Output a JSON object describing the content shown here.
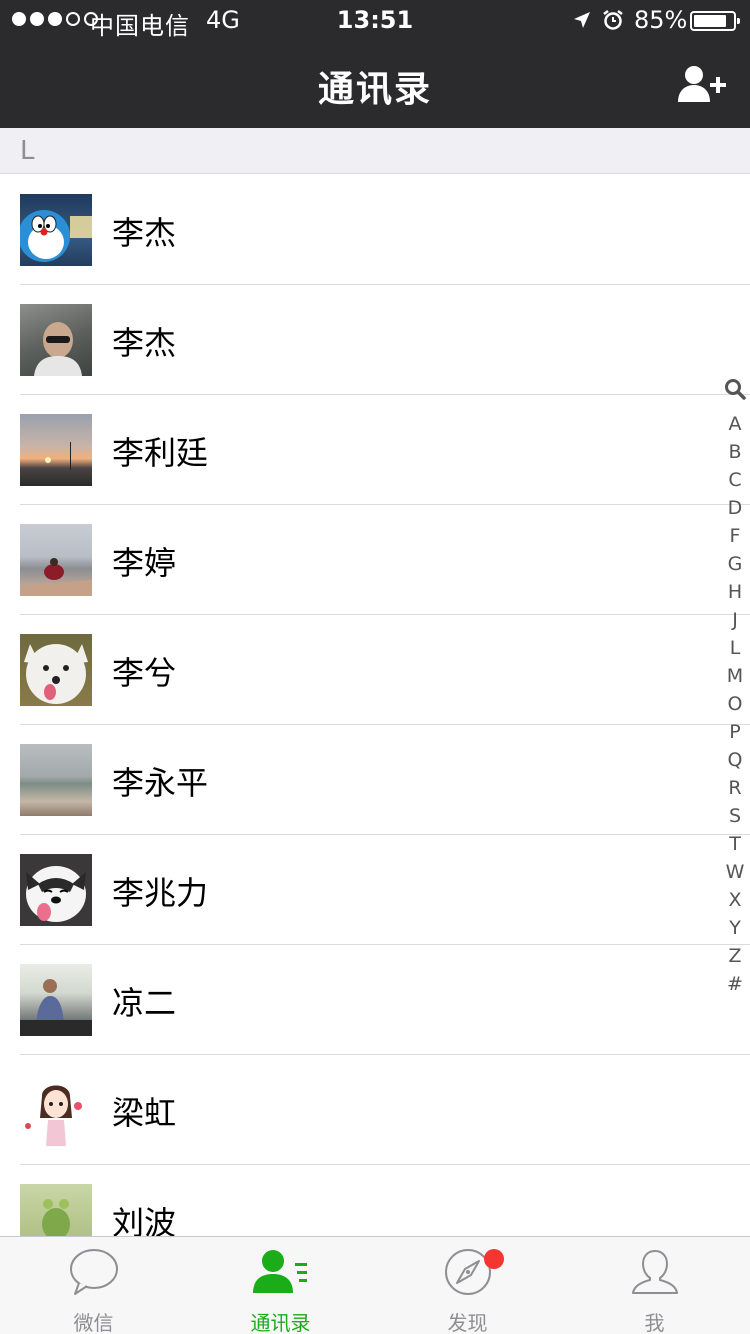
{
  "status_bar": {
    "carrier": "中国电信",
    "network": "4G",
    "time": "13:51",
    "battery_percent": "85%",
    "battery_level": 0.85,
    "signal_strength": 3,
    "signal_max": 5
  },
  "nav": {
    "title": "通讯录",
    "add_contact_icon": "add-contact-icon"
  },
  "section": {
    "letter": "L"
  },
  "contacts": [
    {
      "name": "李杰"
    },
    {
      "name": "李杰"
    },
    {
      "name": "李利廷"
    },
    {
      "name": "李婷"
    },
    {
      "name": "李兮"
    },
    {
      "name": "李永平"
    },
    {
      "name": "李兆力"
    },
    {
      "name": "凉二"
    },
    {
      "name": "梁虹"
    },
    {
      "name": "刘波"
    }
  ],
  "index_bar": [
    "A",
    "B",
    "C",
    "D",
    "F",
    "G",
    "H",
    "J",
    "L",
    "M",
    "O",
    "P",
    "Q",
    "R",
    "S",
    "T",
    "W",
    "X",
    "Y",
    "Z",
    "#"
  ],
  "tabs": [
    {
      "label": "微信",
      "icon": "chat-bubble-icon",
      "active": false
    },
    {
      "label": "通讯录",
      "icon": "contacts-icon",
      "active": true
    },
    {
      "label": "发现",
      "icon": "compass-icon",
      "active": false,
      "badge_dot": true
    },
    {
      "label": "我",
      "icon": "person-icon",
      "active": false
    }
  ],
  "colors": {
    "accent": "#1aad19",
    "nav_bg": "#2b2b2e",
    "badge": "#f43530"
  }
}
